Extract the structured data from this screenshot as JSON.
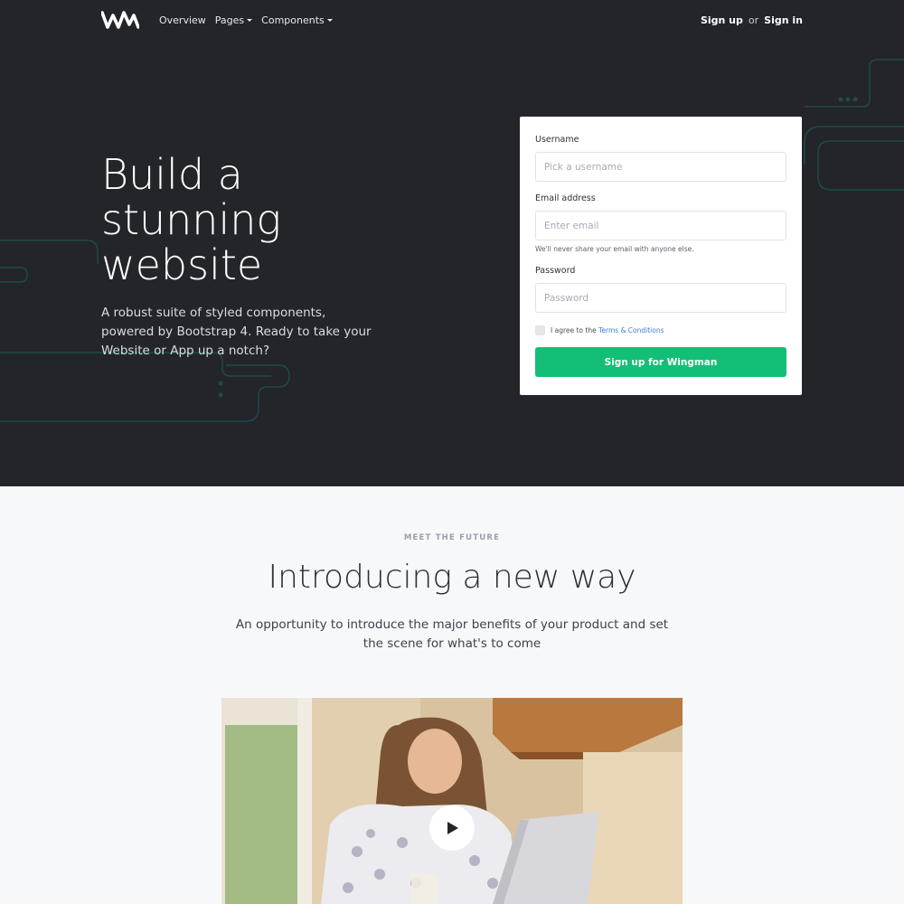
{
  "nav": {
    "links": [
      {
        "label": "Overview",
        "dropdown": false
      },
      {
        "label": "Pages",
        "dropdown": true
      },
      {
        "label": "Components",
        "dropdown": true
      }
    ],
    "sign_up": "Sign up",
    "or": "or",
    "sign_in": "Sign in"
  },
  "hero": {
    "title_lines": [
      "Build a",
      "stunning",
      "website"
    ],
    "subtitle": "A robust suite of styled components, powered by Bootstrap 4. Ready to take your Website or App up a notch?"
  },
  "form": {
    "username_label": "Username",
    "username_placeholder": "Pick a username",
    "email_label": "Email address",
    "email_placeholder": "Enter email",
    "email_help": "We'll never share your email with anyone else.",
    "password_label": "Password",
    "password_placeholder": "Password",
    "agree_prefix": "I agree to the",
    "terms_link": "Terms & Conditions",
    "submit_label": "Sign up for Wingman"
  },
  "section": {
    "eyebrow": "MEET THE FUTURE",
    "title": "Introducing a new way",
    "subtitle": "An opportunity to introduce the major benefits of your product and set the scene for what's to come"
  },
  "icons": {
    "logo": "wingman-logo-icon",
    "caret": "caret-down-icon",
    "play": "play-icon",
    "checkbox": "checkbox-icon"
  },
  "colors": {
    "hero_bg": "#23252b",
    "accent_green": "#13bf76",
    "link_blue": "#3b7ddd",
    "decor_teal": "#1f4a4a",
    "section_bg": "#f7f8fa"
  }
}
